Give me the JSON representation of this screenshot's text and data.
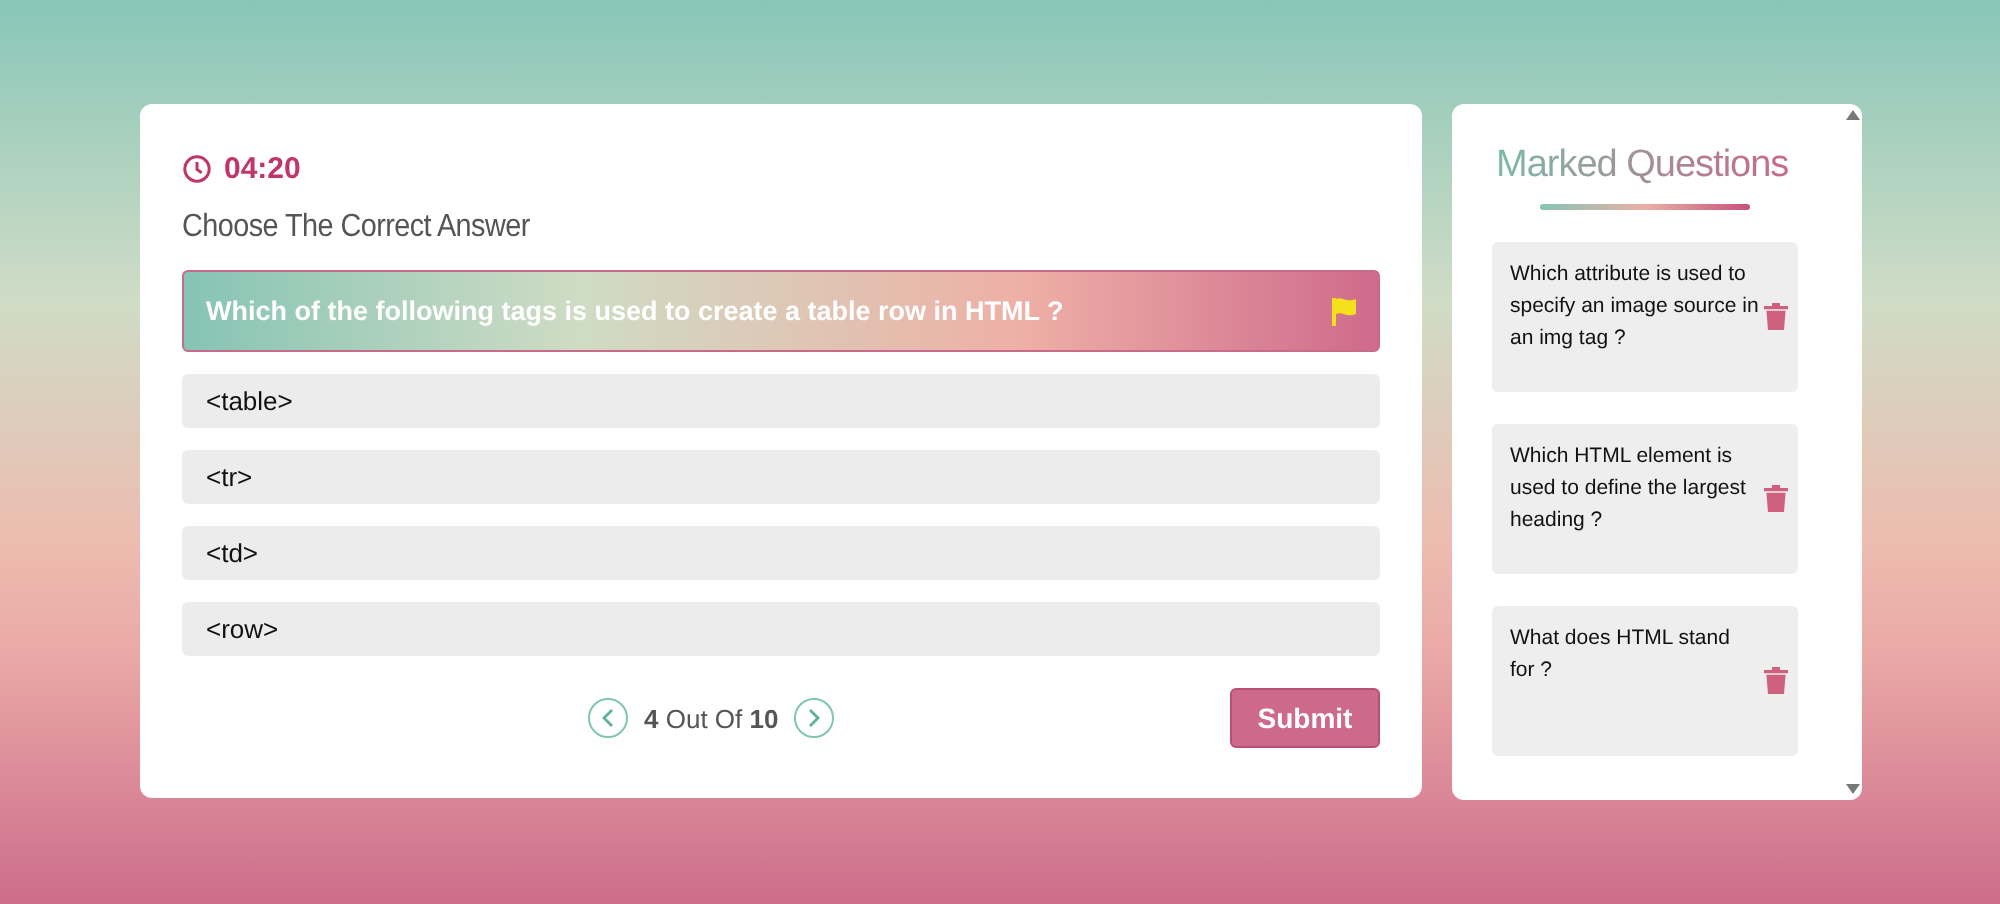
{
  "quiz": {
    "timer": "04:20",
    "heading": "Choose The Correct Answer",
    "question": {
      "text": "Which of the following tags is used to create a table row in HTML ?",
      "flagged": true
    },
    "answers": [
      {
        "text": "<table>",
        "selected": false
      },
      {
        "text": "<tr>",
        "selected": false
      },
      {
        "text": "<td>",
        "selected": false
      },
      {
        "text": "<row>",
        "selected": false
      }
    ],
    "progress": "**4** Out Of **10**",
    "submit": "Submit"
  },
  "marked": {
    "title": "Marked Questions",
    "items": [
      {
        "text": "Which attribute is used to specify an image source in an img tag ?"
      },
      {
        "text": "Which HTML element is used to define the largest heading ?"
      },
      {
        "text": "What does HTML stand for ?"
      }
    ]
  }
}
